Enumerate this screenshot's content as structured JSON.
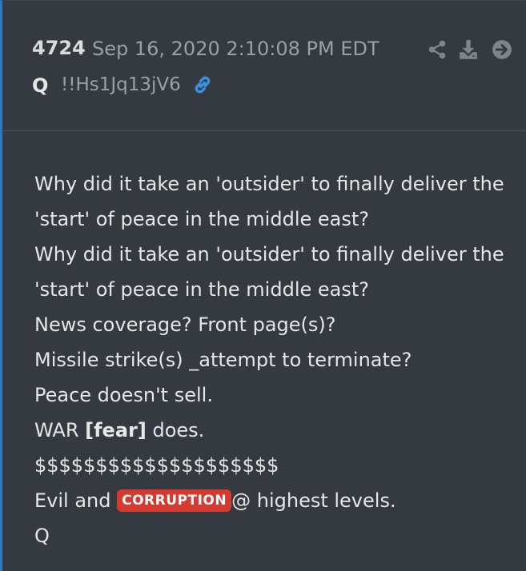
{
  "post": {
    "number": "4724",
    "timestamp": "Sep 16, 2020 2:10:08 PM EDT",
    "author": "Q",
    "tripcode": "!!Hs1Jq13jV6"
  },
  "toolbar": {
    "share_icon": "share-icon",
    "download_icon": "download-icon",
    "forward_icon": "arrow-circle-right-icon",
    "link_icon": "link-icon"
  },
  "body": {
    "line1": "Why did it take an 'outsider' to finally deliver the",
    "line2": "'start' of peace in the middle east?",
    "line3": "Why did it take an 'outsider' to finally deliver the",
    "line4": "'start' of peace in the middle east?",
    "line5": "News coverage? Front page(s)?",
    "line6": "Missile strike(s) _attempt to terminate?",
    "line7": "Peace doesn't sell.",
    "line8_prefix": "WAR ",
    "line8_bold": "[fear]",
    "line8_suffix": " does.",
    "line9": "$$$$$$$$$$$$$$$$$$$$",
    "line10_prefix": "Evil and ",
    "line10_badge": "CORRUPTION",
    "line10_suffix": "@ highest levels.",
    "line11": "Q"
  },
  "colors": {
    "background": "#343a40",
    "accent_border": "#2d78c4",
    "badge": "#d43a2f",
    "link": "#3b8ee0"
  }
}
